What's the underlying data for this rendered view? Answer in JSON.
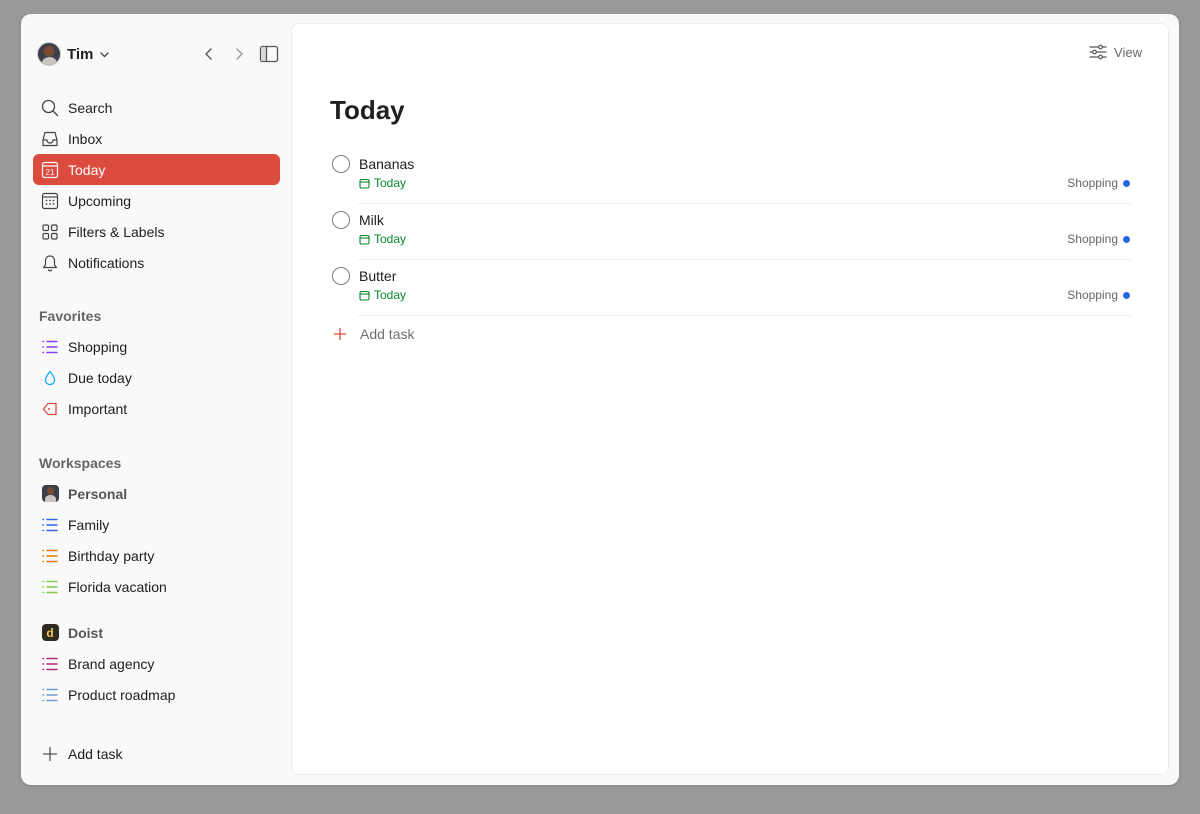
{
  "colors": {
    "accent": "#dc4c3e",
    "due_green": "#058527",
    "project_blue": "#2a67e2",
    "shopping_purple": "#8a3ffc",
    "family_blue": "#2a67e2",
    "birthday_orange": "#e07b00",
    "florida_green": "#7ecc49",
    "brand_magenta": "#b8256f",
    "roadmap_blue": "#6b9bd2"
  },
  "user": {
    "name": "Tim"
  },
  "nav": {
    "items": [
      {
        "label": "Search",
        "icon": "search-icon"
      },
      {
        "label": "Inbox",
        "icon": "inbox-icon"
      },
      {
        "label": "Today",
        "icon": "calendar-today-icon",
        "day": "21",
        "active": true
      },
      {
        "label": "Upcoming",
        "icon": "calendar-grid-icon"
      },
      {
        "label": "Filters & Labels",
        "icon": "filters-grid-icon"
      },
      {
        "label": "Notifications",
        "icon": "bell-icon"
      }
    ]
  },
  "favorites": {
    "title": "Favorites",
    "items": [
      {
        "label": "Shopping",
        "icon": "list-icon"
      },
      {
        "label": "Due today",
        "icon": "drop-icon"
      },
      {
        "label": "Important",
        "icon": "tag-icon"
      }
    ]
  },
  "workspaces": {
    "title": "Workspaces",
    "personal": {
      "label": "Personal",
      "projects": [
        {
          "label": "Family"
        },
        {
          "label": "Birthday party"
        },
        {
          "label": "Florida vacation"
        }
      ]
    },
    "doist": {
      "label": "Doist",
      "logo_letter": "d",
      "projects": [
        {
          "label": "Brand agency"
        },
        {
          "label": "Product roadmap"
        }
      ]
    }
  },
  "sidebar_add_task": "Add task",
  "main": {
    "view_label": "View",
    "title": "Today",
    "tasks": [
      {
        "name": "Bananas",
        "due": "Today",
        "project": "Shopping"
      },
      {
        "name": "Milk",
        "due": "Today",
        "project": "Shopping"
      },
      {
        "name": "Butter",
        "due": "Today",
        "project": "Shopping"
      }
    ],
    "add_task": "Add task"
  }
}
